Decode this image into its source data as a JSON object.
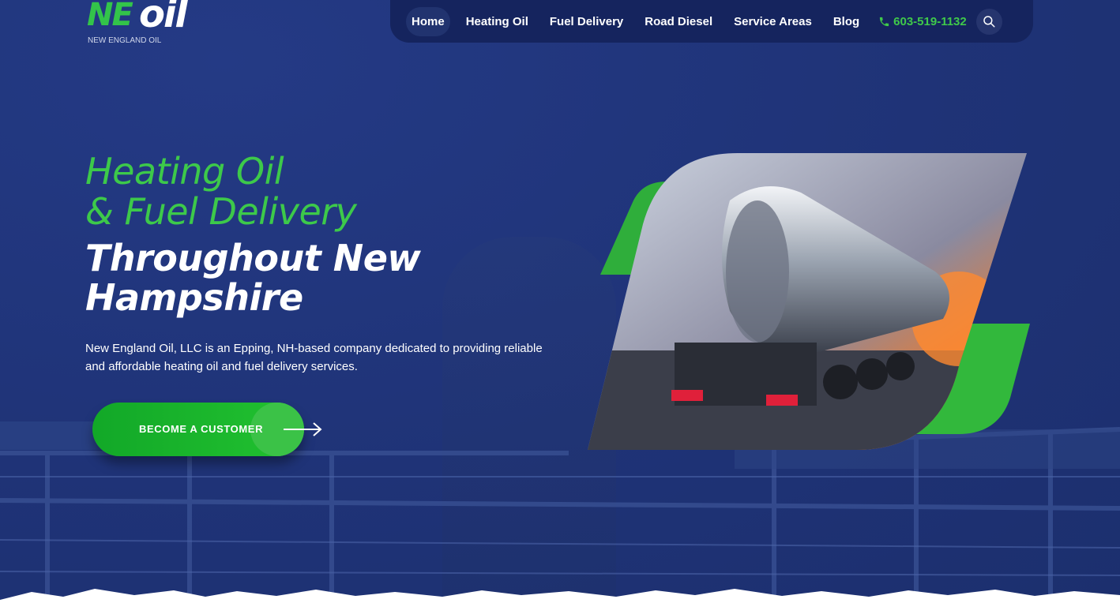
{
  "logo": {
    "mark_ne": "NE",
    "mark_oil": "oil",
    "subtitle": "NEW ENGLAND OIL"
  },
  "nav": {
    "items": [
      {
        "label": "Home",
        "active": true
      },
      {
        "label": "Heating Oil",
        "active": false
      },
      {
        "label": "Fuel Delivery",
        "active": false
      },
      {
        "label": "Road Diesel",
        "active": false
      },
      {
        "label": "Service Areas",
        "active": false
      },
      {
        "label": "Blog",
        "active": false
      }
    ],
    "phone": "603-519-1132",
    "phone_icon": "phone-icon",
    "search_icon": "search-icon"
  },
  "hero": {
    "heading_green_line1": "Heating Oil",
    "heading_green_line2": "& Fuel Delivery",
    "heading_white": "Throughout New Hampshire",
    "description": "New England Oil, LLC is an Epping, NH-based company dedicated to providing reliable and affordable heating oil and fuel delivery services.",
    "cta_label": "BECOME A CUSTOMER",
    "cta_icon": "arrow-right-icon"
  },
  "colors": {
    "brand_green": "#3dc94a",
    "navy": "#1f3377",
    "nav_bg": "#15245e"
  }
}
